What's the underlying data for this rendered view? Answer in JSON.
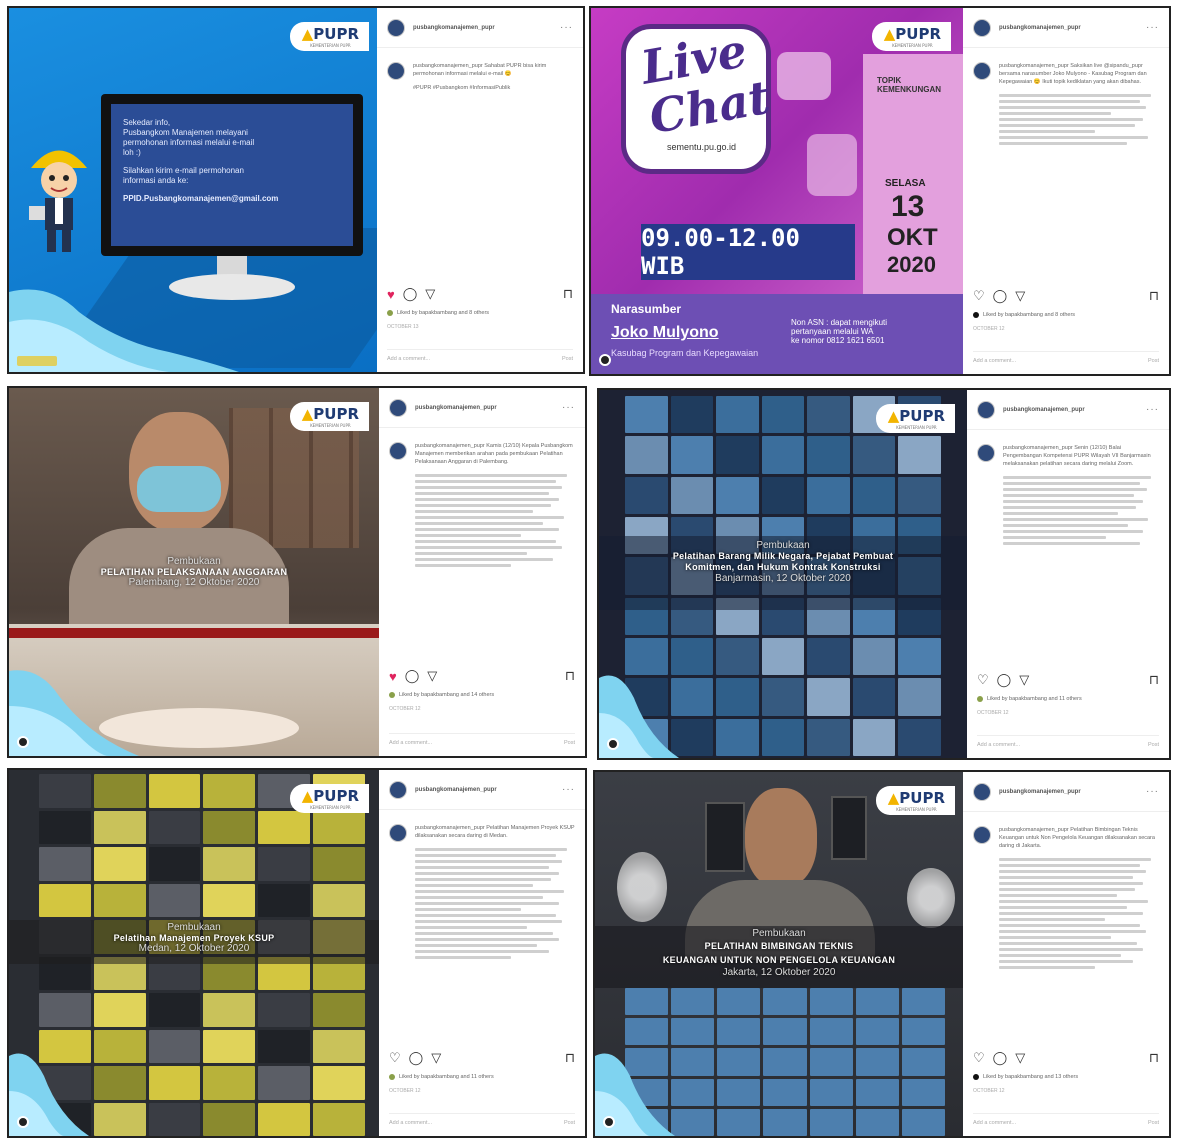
{
  "brand": {
    "logo_text": "PUPR",
    "logo_subtitle": "KEMENTERIAN PUPR",
    "accent": "#1f3b73",
    "gold": "#f2b400",
    "wave_color": "#7fd3f0"
  },
  "posts": [
    {
      "username": "pusbangkomanajemen_pupr",
      "caption": "pusbangkomanajemen_pupr Sahabat PUPR bisa kirim permohonan informasi melalui e-mail 😊",
      "hashtags": "#PUPR #Pusbangkom #InformasiPublik",
      "likes": "Liked by bapakbambang and 8 others",
      "time": "OCTOBER 13",
      "comment_placeholder": "Add a comment...",
      "post_label": "Post",
      "slide": {
        "lines": [
          "Sekedar info,",
          "Pusbangkom Manajemen melayani",
          "permohonan informasi melalui e-mail",
          "loh :)",
          "",
          "Silahkan kirim e-mail permohonan",
          "informasi anda ke:",
          "",
          "PPID.Pusbangkomanajemen@gmail.com"
        ]
      }
    },
    {
      "username": "pusbangkomanajemen_pupr",
      "caption": "pusbangkomanajemen_pupr Saksikan live @sipandu_pupr bersama narasumber Joko Mulyono - Kasubag Program dan Kepegawaian 😊 Ikuti topik kediklatan yang akan dibahas.",
      "likes": "Liked by bapakbambang and 8 others",
      "time": "OCTOBER 12",
      "comment_placeholder": "Add a comment...",
      "post_label": "Post",
      "slide": {
        "live": "Live",
        "chat": "Chat",
        "url": "sementu.pu.go.id",
        "time": "09.00-12.00 WIB",
        "topik_label": "TOPIK\nKEMENKUNGAN",
        "day": "SELASA",
        "date": "13",
        "month": "OKT",
        "year": "2020",
        "narasumber_label": "Narasumber",
        "speaker": "Joko Mulyono",
        "role": "Kasubag Program dan Kepegawaian",
        "note": "Non ASN : dapat mengikuti\npertanyaan melalui WA\nke nomor 0812 1621 6501"
      }
    },
    {
      "username": "pusbangkomanajemen_pupr",
      "caption": "pusbangkomanajemen_pupr Kamis (12/10) Kepala Pusbangkom Manajemen memberikan arahan pada pembukaan Pelatihan Pelaksanaan Anggaran di Palembang.",
      "likes": "Liked by bapakbambang and 14 others",
      "time": "OCTOBER 12",
      "comment_placeholder": "Add a comment...",
      "post_label": "Post",
      "slide": {
        "t1": "Pembukaan",
        "t2": "PELATIHAN PELAKSANAAN ANGGARAN",
        "t3": "Palembang, 12 Oktober 2020"
      }
    },
    {
      "username": "pusbangkomanajemen_pupr",
      "caption": "pusbangkomanajemen_pupr Senin (12/10) Balai Pengembangan Kompetensi PUPR Wilayah VII Banjarmasin melaksanakan pelatihan secara daring melalui Zoom.",
      "likes": "Liked by bapakbambang and 11 others",
      "time": "OCTOBER 12",
      "comment_placeholder": "Add a comment...",
      "post_label": "Post",
      "slide": {
        "t1": "Pembukaan",
        "t2": "Pelatihan Barang Milik Negara, Pejabat Pembuat Komitmen, dan Hukum Kontrak Konstruksi",
        "t3": "Banjarmasin, 12 Oktober 2020"
      }
    },
    {
      "username": "pusbangkomanajemen_pupr",
      "caption": "pusbangkomanajemen_pupr Pelatihan Manajemen Proyek KSUP dilaksanakan secara daring di Medan.",
      "likes": "Liked by bapakbambang and 11 others",
      "time": "OCTOBER 12",
      "comment_placeholder": "Add a comment...",
      "post_label": "Post",
      "slide": {
        "t1": "Pembukaan",
        "t2": "Pelatihan Manajemen Proyek KSUP",
        "t3": "Medan, 12 Oktober 2020"
      }
    },
    {
      "username": "pusbangkomanajemen_pupr",
      "caption": "pusbangkomanajemen_pupr Pelatihan Bimbingan Teknis Keuangan untuk Non Pengelola Keuangan dilaksanakan secara daring di Jakarta.",
      "likes": "Liked by bapakbambang and 13 others",
      "time": "OCTOBER 12",
      "comment_placeholder": "Add a comment...",
      "post_label": "Post",
      "slide": {
        "t1": "Pembukaan",
        "t2": "PELATIHAN BIMBINGAN TEKNIS\nKEUANGAN UNTUK NON PENGELOLA KEUANGAN",
        "t3": "Jakarta, 12 Oktober 2020"
      }
    }
  ],
  "icons": {
    "heart": "heart-icon",
    "comment": "comment-icon",
    "share": "share-icon",
    "bookmark": "bookmark-icon",
    "more": "more-icon"
  }
}
